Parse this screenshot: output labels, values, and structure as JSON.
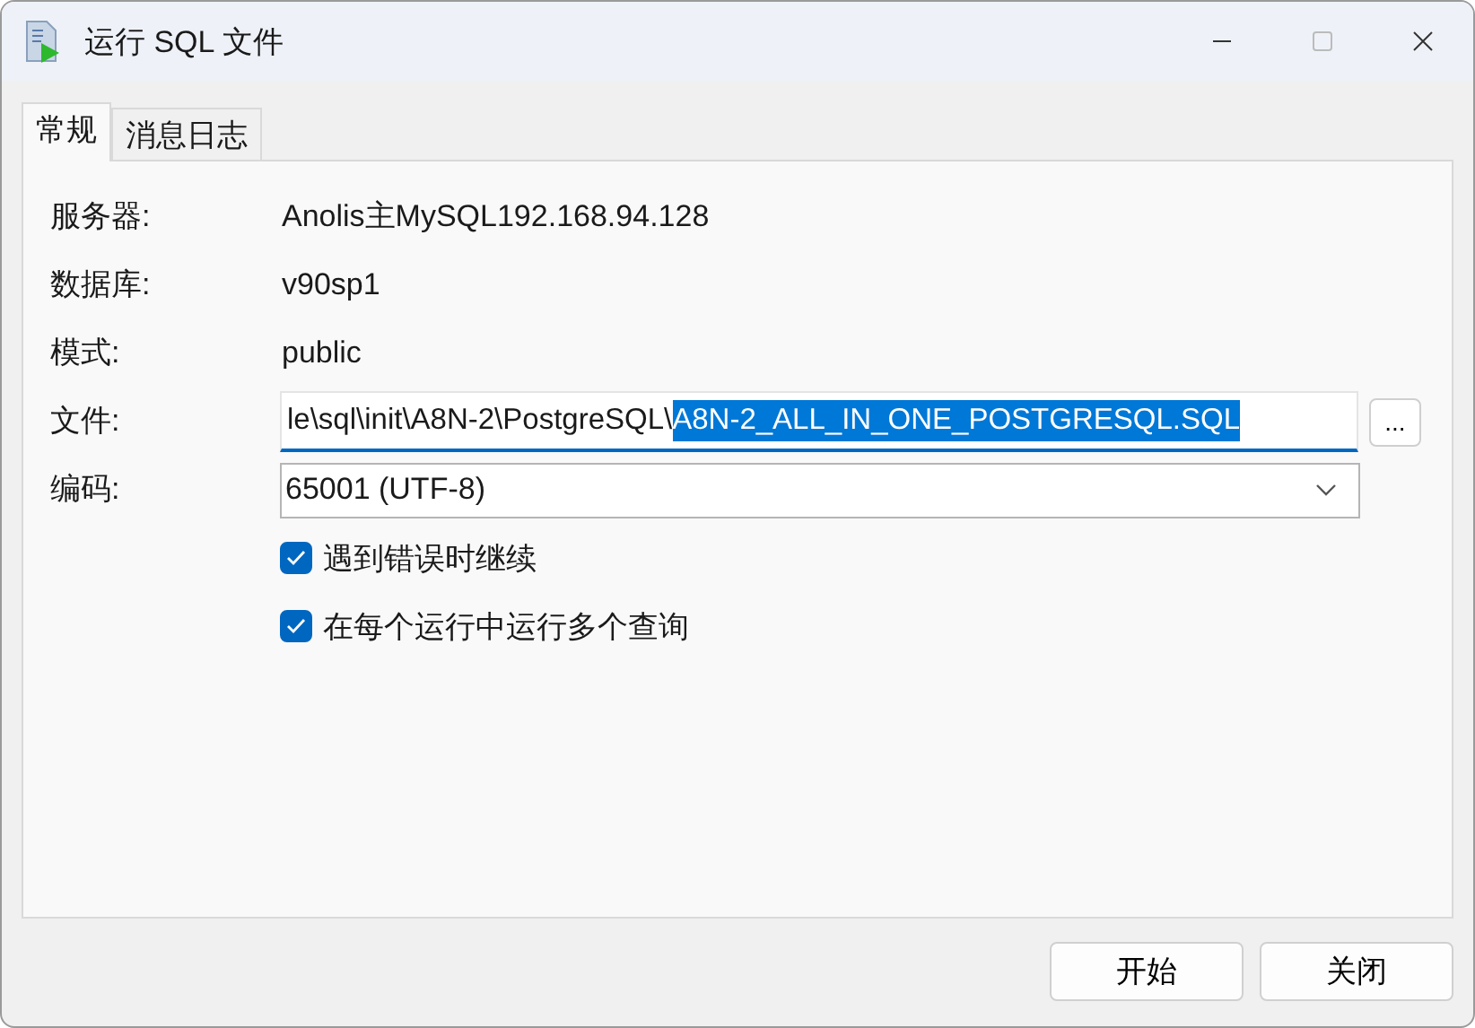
{
  "window": {
    "title": "运行 SQL 文件"
  },
  "tabs": [
    {
      "label": "常规",
      "selected": true
    },
    {
      "label": "消息日志",
      "selected": false
    }
  ],
  "fields": [
    {
      "label": "服务器:",
      "value": "Anolis主MySQL192.168.94.128"
    },
    {
      "label": "数据库:",
      "value": "v90sp1"
    },
    {
      "label": "模式:",
      "value": "public"
    }
  ],
  "file": {
    "label": "文件:",
    "value": "le\\sql\\init\\A8N-2\\PostgreSQL\\",
    "selected_text": "A8N-2_ALL_IN_ONE_POSTGRESQL.SQL",
    "browse": "..."
  },
  "encoding": {
    "label": "编码:",
    "value": "65001 (UTF-8)"
  },
  "options": [
    {
      "label": "遇到错误时继续",
      "checked": true
    },
    {
      "label": "在每个运行中运行多个查询",
      "checked": true
    }
  ],
  "buttons": [
    "开始",
    "关闭"
  ]
}
